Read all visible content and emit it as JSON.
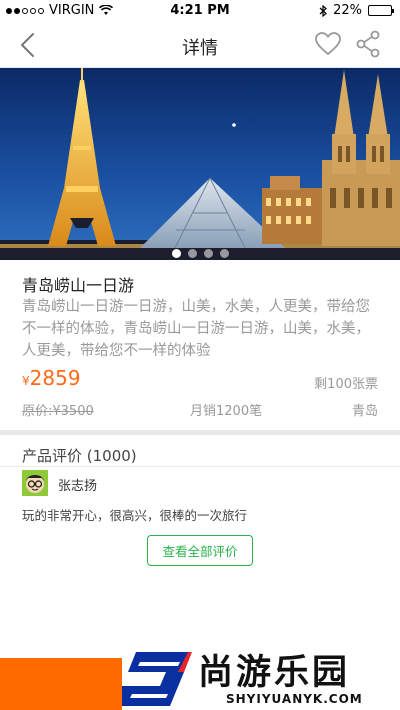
{
  "status_bar": {
    "carrier": "VIRGIN",
    "time": "4:21 PM",
    "battery": "22%",
    "battery_level": 0.22,
    "signal_filled": 2,
    "signal_total": 5
  },
  "nav": {
    "title": "详情",
    "back_icon": "chevron-left-icon",
    "favorite_icon": "heart-outline-icon",
    "share_icon": "share-icon"
  },
  "banner": {
    "page_count": 4,
    "active_page": 1,
    "scene": [
      "eiffel-tower",
      "louvre-pyramid",
      "cologne-cathedral"
    ]
  },
  "product": {
    "title": "青岛崂山一日游",
    "description": "青岛崂山一日游一日游，山美，水美，人更美，带给您不一样的体验，青岛崂山一日游一日游，山美，水美，人更美，带给您不一样的体验",
    "currency": "¥",
    "price": "2859",
    "remaining": "剩100张票",
    "original_price": "原价:¥3500",
    "monthly_sales": "月销1200笔",
    "location": "青岛"
  },
  "reviews": {
    "heading": "产品评价 (1000)",
    "items": [
      {
        "name": "张志扬",
        "text": "玩的非常开心，很高兴，很棒的一次旅行"
      }
    ],
    "view_all": "查看全部评价"
  },
  "footer": {
    "brand": "尚游乐园",
    "url": "SHYIYUANYK.COM",
    "accent": "#ff6a00"
  },
  "colors": {
    "price": "#ff6a1a",
    "button_green": "#2ab34a",
    "muted": "#9a9a9a"
  }
}
